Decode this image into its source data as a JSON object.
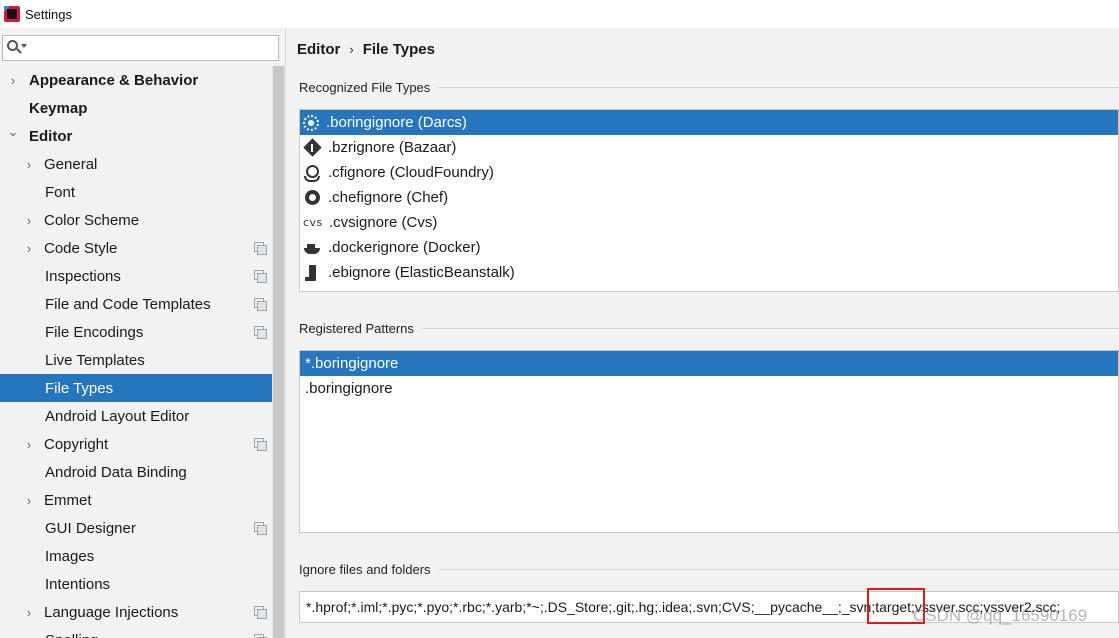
{
  "window": {
    "title": "Settings"
  },
  "search": {
    "value": "",
    "placeholder": ""
  },
  "sidebar": {
    "items": [
      {
        "label": "Appearance & Behavior",
        "level": 0,
        "arrow": "right",
        "bold": true
      },
      {
        "label": "Keymap",
        "level": 0,
        "arrow": "",
        "bold": true
      },
      {
        "label": "Editor",
        "level": 0,
        "arrow": "down",
        "bold": true
      },
      {
        "label": "General",
        "level": 1,
        "arrow": "right"
      },
      {
        "label": "Font",
        "level": 1,
        "arrow": ""
      },
      {
        "label": "Color Scheme",
        "level": 1,
        "arrow": "right"
      },
      {
        "label": "Code Style",
        "level": 1,
        "arrow": "right",
        "project": true
      },
      {
        "label": "Inspections",
        "level": 1,
        "arrow": "",
        "project": true
      },
      {
        "label": "File and Code Templates",
        "level": 1,
        "arrow": "",
        "project": true
      },
      {
        "label": "File Encodings",
        "level": 1,
        "arrow": "",
        "project": true
      },
      {
        "label": "Live Templates",
        "level": 1,
        "arrow": ""
      },
      {
        "label": "File Types",
        "level": 1,
        "arrow": "",
        "selected": true
      },
      {
        "label": "Android Layout Editor",
        "level": 1,
        "arrow": ""
      },
      {
        "label": "Copyright",
        "level": 1,
        "arrow": "right",
        "project": true
      },
      {
        "label": "Android Data Binding",
        "level": 1,
        "arrow": ""
      },
      {
        "label": "Emmet",
        "level": 1,
        "arrow": "right"
      },
      {
        "label": "GUI Designer",
        "level": 1,
        "arrow": "",
        "project": true
      },
      {
        "label": "Images",
        "level": 1,
        "arrow": ""
      },
      {
        "label": "Intentions",
        "level": 1,
        "arrow": ""
      },
      {
        "label": "Language Injections",
        "level": 1,
        "arrow": "right",
        "project": true
      },
      {
        "label": "Spelling",
        "level": 1,
        "arrow": "",
        "project": true
      }
    ]
  },
  "breadcrumb": {
    "parent": "Editor",
    "separator": "›",
    "current": "File Types"
  },
  "recognized": {
    "title": "Recognized File Types",
    "items": [
      {
        "label": ".boringignore (Darcs)",
        "icon": "darcs-icon",
        "selected": true
      },
      {
        "label": ".bzrignore (Bazaar)",
        "icon": "bazaar-icon"
      },
      {
        "label": ".cfignore (CloudFoundry)",
        "icon": "cloudfoundry-icon"
      },
      {
        "label": ".chefignore (Chef)",
        "icon": "chef-icon"
      },
      {
        "label": ".cvsignore (Cvs)",
        "icon": "cvs-icon",
        "icon_text": "cvs"
      },
      {
        "label": ".dockerignore (Docker)",
        "icon": "docker-icon"
      },
      {
        "label": ".ebignore (ElasticBeanstalk)",
        "icon": "elasticbeanstalk-icon"
      }
    ]
  },
  "patterns": {
    "title": "Registered Patterns",
    "items": [
      {
        "label": "*.boringignore",
        "selected": true
      },
      {
        "label": ".boringignore"
      }
    ]
  },
  "ignore": {
    "title": "Ignore files and folders",
    "value": "*.hprof;*.iml;*.pyc;*.pyo;*.rbc;*.yarb;*~;.DS_Store;.git;.hg;.idea;.svn;CVS;__pycache__;_svn;target;vssver.scc;vssver2.scc;"
  },
  "watermark": {
    "text": "CSDN @qq_16590169"
  },
  "colors": {
    "selection": "#2675bf",
    "highlight_box": "#e01818"
  }
}
